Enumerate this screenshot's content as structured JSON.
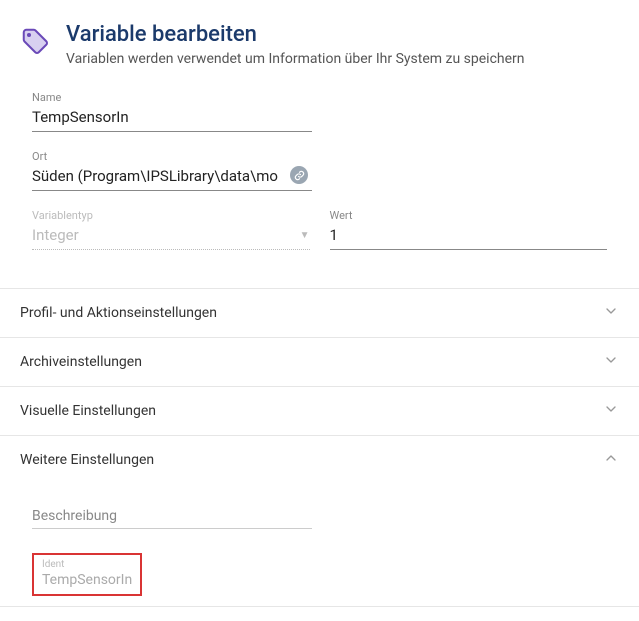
{
  "header": {
    "title": "Variable bearbeiten",
    "subtitle": "Variablen werden verwendet um Information über Ihr System zu speichern"
  },
  "fields": {
    "name": {
      "label": "Name",
      "value": "TempSensorIn"
    },
    "ort": {
      "label": "Ort",
      "value": "Süden (Program\\IPSLibrary\\data\\mo"
    },
    "typ": {
      "label": "Variablentyp",
      "value": "Integer"
    },
    "wert": {
      "label": "Wert",
      "value": "1"
    }
  },
  "accordion": {
    "profil": "Profil- und Aktionseinstellungen",
    "archiv": "Archiveinstellungen",
    "visuell": "Visuelle Einstellungen",
    "weitere": "Weitere Einstellungen"
  },
  "weitere_body": {
    "beschreibung_label": "Beschreibung",
    "ident": {
      "label": "Ident",
      "value": "TempSensorIn"
    }
  }
}
